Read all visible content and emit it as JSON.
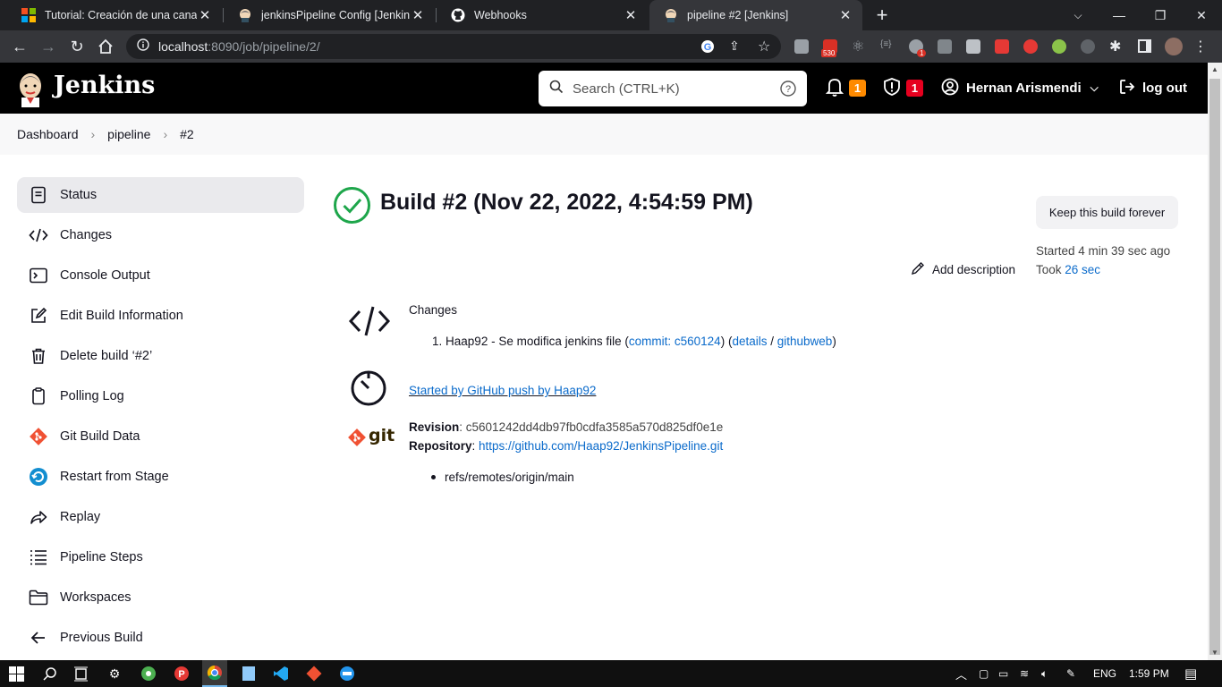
{
  "browser": {
    "tabs": [
      {
        "title": "Tutorial: Creación de una canaliz",
        "favicon": "windows-icon",
        "active": false
      },
      {
        "title": "jenkinsPipeline Config [Jenkins]",
        "favicon": "jenkins-icon",
        "active": false
      },
      {
        "title": "Webhooks",
        "favicon": "github-icon",
        "active": false
      },
      {
        "title": "pipeline #2 [Jenkins]",
        "favicon": "jenkins-icon",
        "active": true
      }
    ],
    "url_host": "localhost",
    "url_path": ":8090/job/pipeline/2/",
    "mail_badge": "530",
    "ext_badge": "1"
  },
  "jenkins": {
    "brand": "Jenkins",
    "search_placeholder": "Search (CTRL+K)",
    "notifications_count": "1",
    "security_count": "1",
    "user_name": "Hernan Arismendi",
    "logout_label": "log out",
    "colors": {
      "notification": "#fe8a00",
      "security": "#e6001f",
      "success": "#1ea64b",
      "link": "#0b6bcb"
    }
  },
  "breadcrumb": [
    "Dashboard",
    "pipeline",
    "#2"
  ],
  "sidebar": {
    "items": [
      {
        "label": "Status",
        "icon": "status-icon"
      },
      {
        "label": "Changes",
        "icon": "code-icon"
      },
      {
        "label": "Console Output",
        "icon": "terminal-icon"
      },
      {
        "label": "Edit Build Information",
        "icon": "edit-icon"
      },
      {
        "label": "Delete build ‘#2’",
        "icon": "trash-icon"
      },
      {
        "label": "Polling Log",
        "icon": "clipboard-icon"
      },
      {
        "label": "Git Build Data",
        "icon": "git-icon"
      },
      {
        "label": "Restart from Stage",
        "icon": "restart-icon"
      },
      {
        "label": "Replay",
        "icon": "replay-icon"
      },
      {
        "label": "Pipeline Steps",
        "icon": "steps-icon"
      },
      {
        "label": "Workspaces",
        "icon": "folder-icon"
      },
      {
        "label": "Previous Build",
        "icon": "arrow-left-icon"
      }
    ]
  },
  "build": {
    "title": "Build #2 (Nov 22, 2022, 4:54:59 PM)",
    "keep_label": "Keep this build forever",
    "started": "Started 4 min 39 sec ago",
    "took_label": "Took ",
    "took_value": "26 sec",
    "add_description": "Add description",
    "changes_heading": "Changes",
    "change_item": {
      "number": "1.",
      "text": "Haap92 - Se modifica jenkins file (",
      "commit_link": "commit: c560124",
      "mid": ") (",
      "details_link": "details",
      "slash": " / ",
      "githubweb_link": "githubweb",
      "close": ")"
    },
    "cause_link": "Started by GitHub push by Haap92",
    "revision_label": "Revision",
    "revision_value": ": c5601242dd4db97fb0cdfa3585a570d825df0e1e",
    "repository_label": "Repository",
    "repository_sep": ": ",
    "repository_link": "https://github.com/Haap92/JenkinsPipeline.git",
    "branch": "refs/remotes/origin/main",
    "git_logo_text": "git"
  },
  "taskbar": {
    "language": "ENG",
    "time": "1:59 PM"
  }
}
